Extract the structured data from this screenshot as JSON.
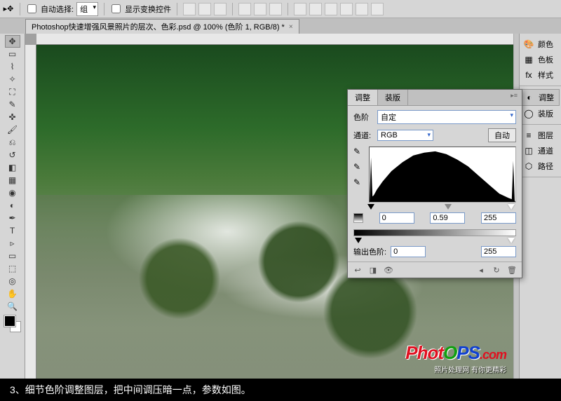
{
  "optionsbar": {
    "auto_select_label": "自动选择:",
    "auto_select_value": "组",
    "show_transform_label": "显示变换控件"
  },
  "document": {
    "tab_title": "Photoshop快速增强风景照片的层次、色彩.psd @ 100% (色阶 1, RGB/8) *"
  },
  "rightpanels": {
    "color": "颜色",
    "swatches": "色板",
    "styles": "样式",
    "adjustments": "调整",
    "masks": "装版",
    "layers": "图层",
    "channels": "通道",
    "paths": "路径"
  },
  "levels": {
    "tab_adjust": "调整",
    "tab_mask": "装版",
    "type_label": "色阶",
    "preset": "自定",
    "channel_label": "通道:",
    "channel_value": "RGB",
    "auto_btn": "自动",
    "in_black": "0",
    "in_gamma": "0.59",
    "in_white": "255",
    "output_label": "输出色阶:",
    "out_black": "0",
    "out_white": "255"
  },
  "watermark": {
    "logo_p1": "Phot",
    "logo_p2": "O",
    "logo_p3": "PS",
    "logo_p4": ".com",
    "tagline": "照片处理网 有你更精彩"
  },
  "caption": "3、细节色阶调整图层，把中间调压暗一点，参数如图。"
}
